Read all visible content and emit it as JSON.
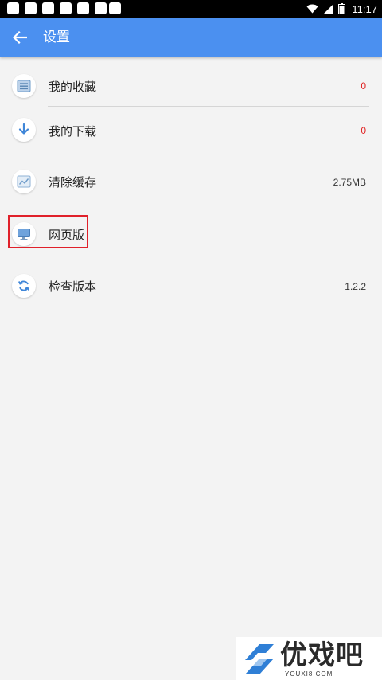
{
  "status_bar": {
    "time": "11:17",
    "icons": [
      "wifi-icon",
      "signal-icon",
      "battery-icon"
    ]
  },
  "app_bar": {
    "title": "设置",
    "back_icon": "arrow-left-icon"
  },
  "settings": {
    "items": [
      {
        "label": "我的收藏",
        "value": "0",
        "icon": "favorites-icon"
      },
      {
        "label": "我的下载",
        "value": "0",
        "icon": "download-icon"
      },
      {
        "label": "清除缓存",
        "value": "2.75MB",
        "icon": "clear-cache-icon"
      },
      {
        "label": "网页版",
        "value": "",
        "icon": "monitor-icon"
      },
      {
        "label": "检查版本",
        "value": "1.2.2",
        "icon": "refresh-icon"
      }
    ]
  },
  "colors": {
    "app_bar": "#4b90f0",
    "background": "#f3f3f3",
    "count_value": "#e02020",
    "highlight": "#e0202a"
  },
  "watermark": {
    "text": "优戏吧",
    "domain": "YOUXI8.COM"
  }
}
